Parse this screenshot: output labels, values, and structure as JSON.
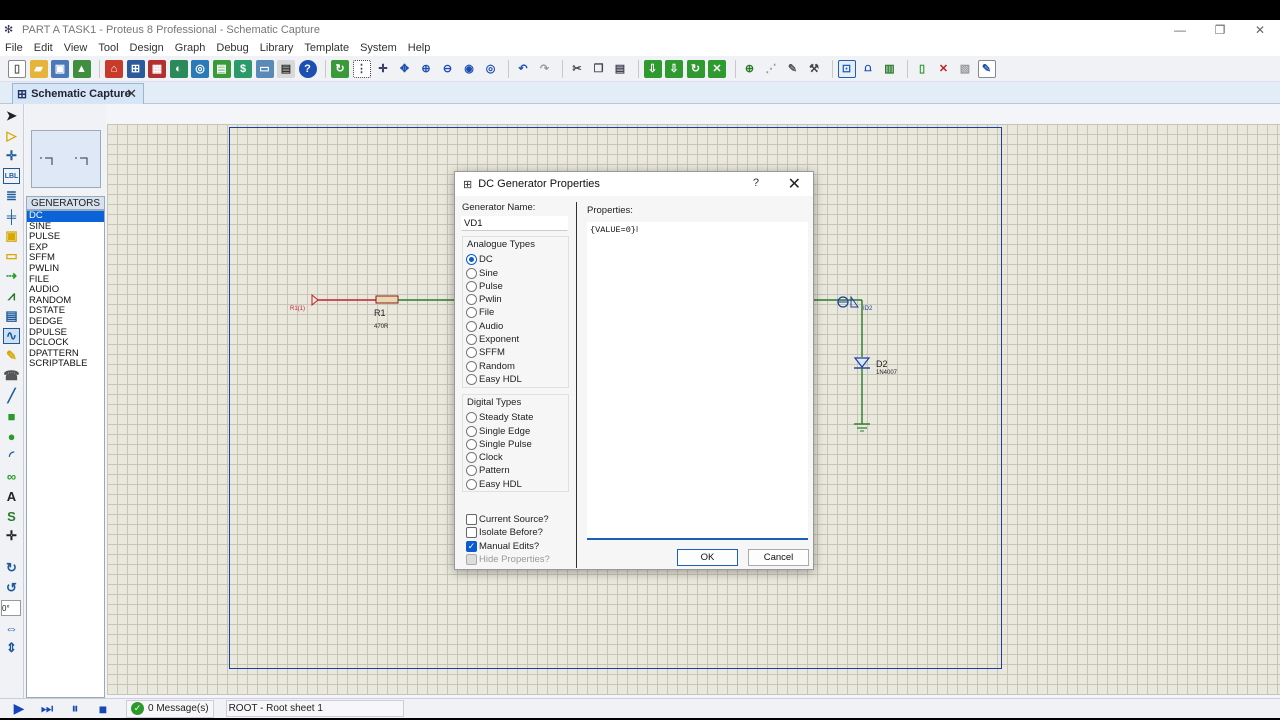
{
  "window": {
    "title": "PART A TASK1 - Proteus 8 Professional - Schematic Capture",
    "min": "—",
    "max": "❐",
    "close": "✕"
  },
  "menu": [
    "File",
    "Edit",
    "View",
    "Tool",
    "Design",
    "Graph",
    "Debug",
    "Library",
    "Template",
    "System",
    "Help"
  ],
  "tab": {
    "label": "Schematic Capture",
    "close": "✕"
  },
  "panel": {
    "header": "GENERATORS",
    "items": [
      "DC",
      "SINE",
      "PULSE",
      "EXP",
      "SFFM",
      "PWLIN",
      "FILE",
      "AUDIO",
      "RANDOM",
      "DSTATE",
      "DEDGE",
      "DPULSE",
      "DCLOCK",
      "DPATTERN",
      "SCRIPTABLE"
    ],
    "selected": "DC"
  },
  "rotation_field": "0°",
  "schematic": {
    "terminal_left": "R1(1)",
    "resistor_ref": "R1",
    "resistor_value": "470R",
    "probe_label": "ID2",
    "diode_ref": "D2",
    "diode_value": "1N4007"
  },
  "dialog": {
    "title": "DC Generator Properties",
    "help": "?",
    "close": "✕",
    "name_label": "Generator Name:",
    "name_value": "VD1",
    "analogue_label": "Analogue Types",
    "analogue": [
      "DC",
      "Sine",
      "Pulse",
      "Pwlin",
      "File",
      "Audio",
      "Exponent",
      "SFFM",
      "Random",
      "Easy HDL"
    ],
    "analogue_selected": "DC",
    "digital_label": "Digital Types",
    "digital": [
      "Steady State",
      "Single Edge",
      "Single Pulse",
      "Clock",
      "Pattern",
      "Easy HDL"
    ],
    "options": [
      {
        "label": "Current Source?",
        "checked": false,
        "disabled": false
      },
      {
        "label": "Isolate Before?",
        "checked": false,
        "disabled": false
      },
      {
        "label": "Manual Edits?",
        "checked": true,
        "disabled": false
      },
      {
        "label": "Hide Properties?",
        "checked": false,
        "disabled": true
      }
    ],
    "properties_label": "Properties:",
    "properties_text": "{VALUE=0}",
    "ok": "OK",
    "cancel": "Cancel"
  },
  "status": {
    "messages": "0 Message(s)",
    "sheet": "ROOT - Root sheet 1"
  },
  "colors": {
    "accent": "#1d5fb3",
    "canvas": "#eae8dc",
    "wire_red": "#c0202a",
    "wire_green": "#2a7a2a"
  }
}
